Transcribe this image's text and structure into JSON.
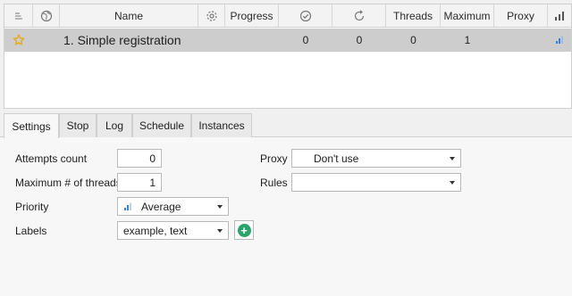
{
  "grid": {
    "columns": {
      "name": "Name",
      "progress": "Progress",
      "threads": "Threads",
      "maximum": "Maximum",
      "proxy": "Proxy"
    },
    "header_icons": [
      "sort-icon",
      "globe-icon",
      "gear-icon",
      "check-circle-icon",
      "refresh-icon",
      "bar-chart-icon"
    ],
    "rows": [
      {
        "favorite_icon": "star-icon",
        "name": "1. Simple registration",
        "success": "0",
        "failed": "0",
        "threads": "0",
        "maximum": "1",
        "priority_icon": "bar-chart-icon"
      }
    ]
  },
  "tabs": [
    "Settings",
    "Stop",
    "Log",
    "Schedule",
    "Instances"
  ],
  "active_tab": "Settings",
  "settings": {
    "attempts_label": "Attempts count",
    "attempts_value": "0",
    "max_threads_label": "Maximum # of threads",
    "max_threads_value": "1",
    "priority_label": "Priority",
    "priority_value": "Average",
    "labels_label": "Labels",
    "labels_value": "example, text",
    "proxy_label": "Proxy",
    "proxy_value": "Don't use",
    "rules_label": "Rules",
    "rules_value": ""
  },
  "colors": {
    "star": "#e6a817",
    "chart_icon": "#3a7fd5",
    "add_button": "#2aa36a",
    "selected_row": "#cdcdcd"
  }
}
